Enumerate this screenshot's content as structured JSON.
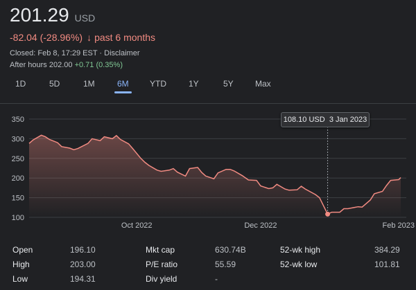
{
  "quote": {
    "price": "201.29",
    "currency": "USD",
    "change": "-82.04 (-28.96%)",
    "change_arrow": "↓",
    "period": "past 6 months",
    "closed": "Closed: Feb 8, 17:29 EST · Disclaimer",
    "afterhours_label": "After hours 202.00",
    "afterhours_change": "+0.71 (0.35%)"
  },
  "tabs": [
    {
      "label": "1D"
    },
    {
      "label": "5D"
    },
    {
      "label": "1M"
    },
    {
      "label": "6M",
      "active": true
    },
    {
      "label": "YTD"
    },
    {
      "label": "1Y"
    },
    {
      "label": "5Y"
    },
    {
      "label": "Max"
    }
  ],
  "tooltip": {
    "value": "108.10 USD",
    "date": "3 Jan 2023"
  },
  "stats": {
    "open_label": "Open",
    "open": "196.10",
    "high_label": "High",
    "high": "203.00",
    "low_label": "Low",
    "low": "194.31",
    "mktcap_label": "Mkt cap",
    "mktcap": "630.74B",
    "pe_label": "P/E ratio",
    "pe": "55.59",
    "divyield_label": "Div yield",
    "divyield": "-",
    "wk52high_label": "52-wk high",
    "wk52high": "384.29",
    "wk52low_label": "52-wk low",
    "wk52low": "101.81"
  },
  "colors": {
    "line": "#f28b82",
    "accent": "#8ab4f8",
    "negative": "#f28b82",
    "positive": "#81c995"
  },
  "chart_data": {
    "type": "line",
    "ylim": [
      100,
      350
    ],
    "ytick_labels": [
      "350",
      "300",
      "250",
      "200",
      "150",
      "100"
    ],
    "yticks": [
      350,
      300,
      250,
      200,
      150,
      100
    ],
    "xtick_labels": [
      "Oct 2022",
      "Dec 2022",
      "Feb 2023"
    ],
    "x": [
      "2022-08-09",
      "2022-08-11",
      "2022-08-15",
      "2022-08-17",
      "2022-08-19",
      "2022-08-23",
      "2022-08-25",
      "2022-08-29",
      "2022-08-31",
      "2022-09-02",
      "2022-09-07",
      "2022-09-09",
      "2022-09-13",
      "2022-09-15",
      "2022-09-19",
      "2022-09-21",
      "2022-09-23",
      "2022-09-27",
      "2022-09-29",
      "2022-10-03",
      "2022-10-05",
      "2022-10-07",
      "2022-10-11",
      "2022-10-13",
      "2022-10-17",
      "2022-10-19",
      "2022-10-21",
      "2022-10-25",
      "2022-10-27",
      "2022-10-31",
      "2022-11-02",
      "2022-11-04",
      "2022-11-08",
      "2022-11-10",
      "2022-11-14",
      "2022-11-16",
      "2022-11-18",
      "2022-11-22",
      "2022-11-25",
      "2022-11-29",
      "2022-12-01",
      "2022-12-05",
      "2022-12-07",
      "2022-12-09",
      "2022-12-13",
      "2022-12-15",
      "2022-12-19",
      "2022-12-21",
      "2022-12-23",
      "2022-12-28",
      "2022-12-30",
      "2023-01-03",
      "2023-01-05",
      "2023-01-09",
      "2023-01-11",
      "2023-01-13",
      "2023-01-18",
      "2023-01-20",
      "2023-01-24",
      "2023-01-26",
      "2023-01-30",
      "2023-02-01",
      "2023-02-03",
      "2023-02-07",
      "2023-02-08"
    ],
    "series": [
      {
        "values": [
          288,
          297,
          309,
          305,
          298,
          290,
          280,
          276,
          272,
          275,
          288,
          300,
          295,
          305,
          300,
          308,
          298,
          287,
          275,
          250,
          240,
          232,
          220,
          217,
          220,
          224,
          215,
          205,
          224,
          227,
          214,
          205,
          198,
          213,
          222,
          222,
          218,
          206,
          195,
          194,
          180,
          173,
          175,
          184,
          172,
          169,
          170,
          179,
          172,
          158,
          150,
          108,
          113,
          113,
          122,
          122,
          127,
          126,
          144,
          160,
          166,
          181,
          194,
          196,
          201.29
        ]
      }
    ],
    "highlight": {
      "x": "2023-01-03",
      "y": 108.1
    }
  }
}
